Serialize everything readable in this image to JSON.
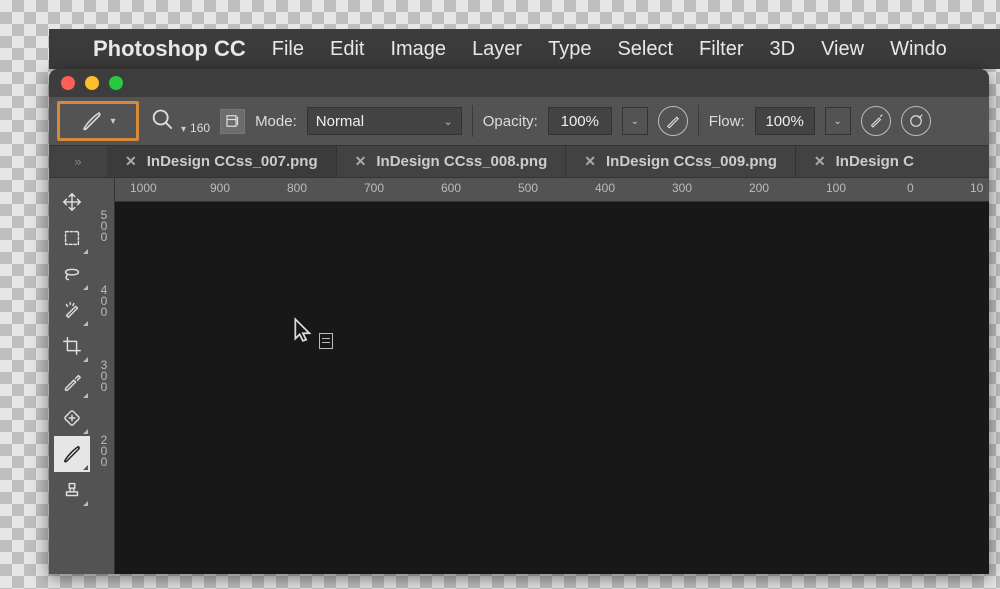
{
  "menubar": {
    "app_name": "Photoshop CC",
    "items": [
      "File",
      "Edit",
      "Image",
      "Layer",
      "Type",
      "Select",
      "Filter",
      "3D",
      "View",
      "Windo"
    ]
  },
  "options": {
    "brush_size": "160",
    "mode_label": "Mode:",
    "mode_value": "Normal",
    "opacity_label": "Opacity:",
    "opacity_value": "100%",
    "flow_label": "Flow:",
    "flow_value": "100%"
  },
  "tabs": [
    {
      "name": "InDesign CCss_007.png"
    },
    {
      "name": "InDesign CCss_008.png"
    },
    {
      "name": "InDesign CCss_009.png"
    },
    {
      "name": "InDesign C"
    }
  ],
  "ruler_top": [
    "1000",
    "900",
    "800",
    "700",
    "600",
    "500",
    "400",
    "300",
    "200",
    "100",
    "0",
    "10"
  ],
  "ruler_left": [
    "500",
    "400",
    "300",
    "200"
  ],
  "tools": [
    {
      "name": "move-tool"
    },
    {
      "name": "marquee-tool"
    },
    {
      "name": "lasso-tool"
    },
    {
      "name": "quick-select-tool"
    },
    {
      "name": "crop-tool"
    },
    {
      "name": "eyedropper-tool"
    },
    {
      "name": "healing-brush-tool"
    },
    {
      "name": "brush-tool",
      "active": true
    },
    {
      "name": "stamp-tool"
    }
  ]
}
